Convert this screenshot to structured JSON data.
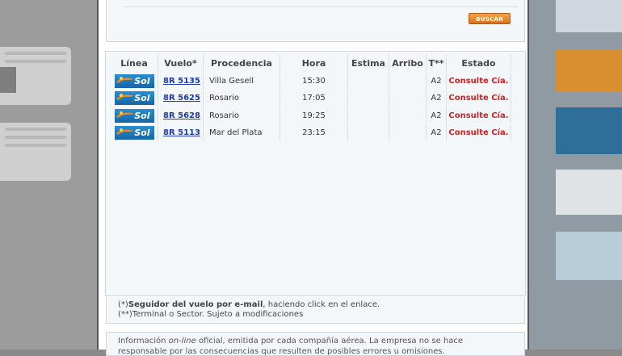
{
  "search": {
    "button_label": "BUSCAR"
  },
  "table": {
    "headers": {
      "linea": "Línea",
      "vuelo": "Vuelo*",
      "procedencia": "Procedencia",
      "hora": "Hora",
      "estima": "Estima",
      "arribo": "Arribo",
      "terminal": "T**",
      "estado": "Estado"
    },
    "rows": [
      {
        "airline": "Sol",
        "flight": "8R 5135",
        "origin": "Villa Gesell",
        "time": "15:30",
        "estimated": "",
        "arrival": "",
        "terminal": "A2",
        "status": "Consulte Cía."
      },
      {
        "airline": "Sol",
        "flight": "8R 5625",
        "origin": "Rosario",
        "time": "17:05",
        "estimated": "",
        "arrival": "",
        "terminal": "A2",
        "status": "Consulte Cía."
      },
      {
        "airline": "Sol",
        "flight": "8R 5628",
        "origin": "Rosario",
        "time": "19:25",
        "estimated": "",
        "arrival": "",
        "terminal": "A2",
        "status": "Consulte Cía."
      },
      {
        "airline": "Sol",
        "flight": "8R 5113",
        "origin": "Mar del Plata",
        "time": "23:15",
        "estimated": "",
        "arrival": "",
        "terminal": "A2",
        "status": "Consulte Cía."
      }
    ]
  },
  "notes": {
    "line1_prefix": "(*)",
    "line1_bold": "Seguidor del vuelo por e-mail",
    "line1_rest": ", haciendo click en el enlace.",
    "line2": "(**)Terminal o Sector. Sujeto a modificaciones"
  },
  "disclaimer": {
    "prefix": "Información ",
    "italic": "on-line",
    "rest": " oficial, emitida por cada compañía aérea. La empresa no se hace responsable por las consecuencias que resulten de posibles errores u omisiones."
  },
  "colors": {
    "accent_orange": "#e0852a",
    "status_red": "#d42020",
    "link_blue": "#1f3aa8",
    "sol_blue": "#1e7cc0"
  }
}
